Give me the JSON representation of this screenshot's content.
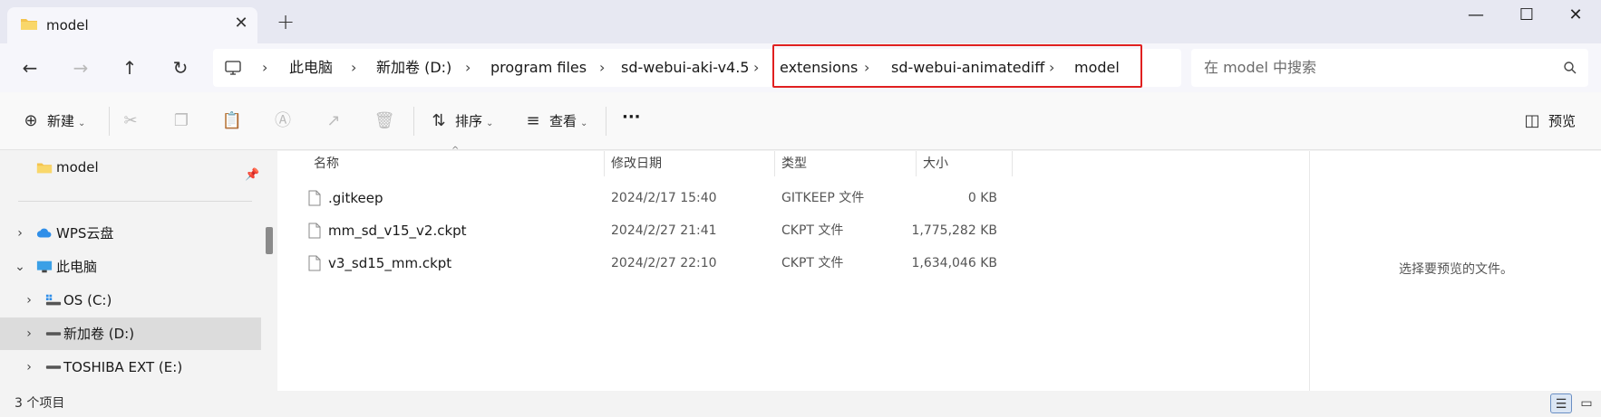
{
  "tab": {
    "title": "model",
    "icon": "folder-icon"
  },
  "window_controls": {
    "minimize": "—",
    "maximize": "☐",
    "close": "✕"
  },
  "breadcrumb": {
    "items": [
      "此电脑",
      "新加卷 (D:)",
      "program files",
      "sd-webui-aki-v4.5",
      "extensions",
      "sd-webui-animatediff",
      "model"
    ],
    "separator": "›"
  },
  "search": {
    "placeholder": "在 model 中搜索"
  },
  "toolbar": {
    "new_label": "新建",
    "sort_label": "排序",
    "view_label": "查看",
    "more_label": "···",
    "preview_label": "预览"
  },
  "nav": {
    "pinned": {
      "label": "model"
    },
    "items": [
      {
        "label": "WPS云盘",
        "expanded": false
      },
      {
        "label": "此电脑",
        "expanded": true
      },
      {
        "label": "OS (C:)",
        "expanded": false
      },
      {
        "label": "新加卷 (D:)",
        "expanded": false,
        "selected": true
      },
      {
        "label": "TOSHIBA EXT (E:)",
        "expanded": false
      }
    ]
  },
  "columns": {
    "name": "名称",
    "modified": "修改日期",
    "type": "类型",
    "size": "大小"
  },
  "files": [
    {
      "name": ".gitkeep",
      "modified": "2024/2/17 15:40",
      "type": "GITKEEP 文件",
      "size": "0 KB"
    },
    {
      "name": "mm_sd_v15_v2.ckpt",
      "modified": "2024/2/27 21:41",
      "type": "CKPT 文件",
      "size": "1,775,282 KB"
    },
    {
      "name": "v3_sd15_mm.ckpt",
      "modified": "2024/2/27 22:10",
      "type": "CKPT 文件",
      "size": "1,634,046 KB"
    }
  ],
  "preview": {
    "message": "选择要预览的文件。"
  },
  "status": {
    "item_count": "3 个项目"
  },
  "colors": {
    "accent": "#0067c0",
    "highlight": "#e02020",
    "folder": "#f4c44e"
  }
}
